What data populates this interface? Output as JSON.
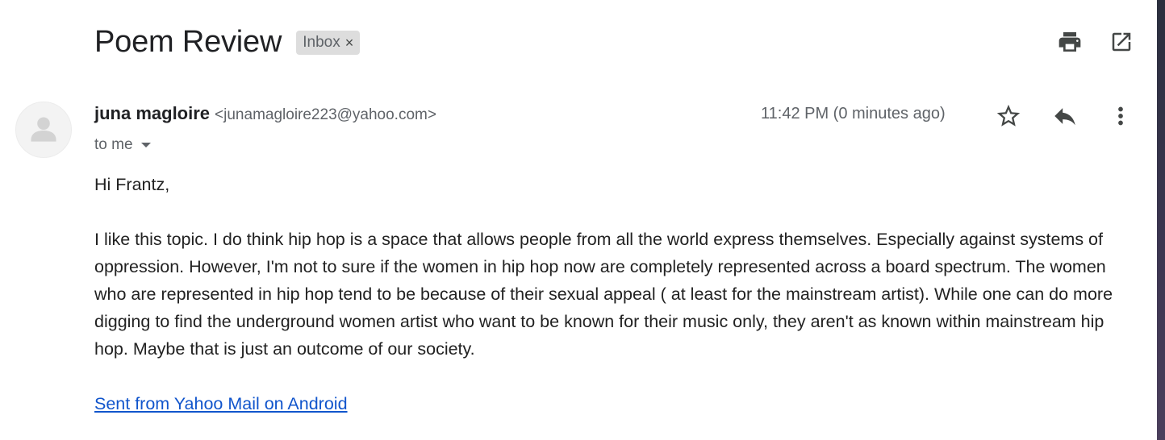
{
  "message": {
    "subject": "Poem Review",
    "label": "Inbox",
    "label_remove": "×",
    "sender": {
      "name": "juna magloire",
      "email": "<junamagloire223@yahoo.com>"
    },
    "recipient": "to me",
    "timestamp": "11:42 PM (0 minutes ago)",
    "greeting": "Hi Frantz,",
    "body": "I like this topic. I do think hip hop is a space that allows people from all the world express themselves. Especially against systems of oppression. However, I'm not to sure if the women in hip hop now are completely represented across a board spectrum. The women who are represented in hip hop tend to be because of their sexual appeal ( at least for the mainstream artist). While one can do more digging to find the underground women artist who want to be known for their music only, they aren't as known within mainstream hip hop. Maybe that is just an outcome of our society.",
    "signature": "Sent from Yahoo Mail on Android"
  },
  "icons": {
    "print": "print-icon",
    "open_new_window": "open-in-new-window-icon",
    "star": "star-icon",
    "reply": "reply-icon",
    "more": "more-vertical-icon",
    "avatar": "default-avatar-icon"
  },
  "colors": {
    "link": "#1155cc",
    "label_bg": "#dddddd",
    "secondary_text": "#5f6368",
    "icon": "#444746"
  }
}
